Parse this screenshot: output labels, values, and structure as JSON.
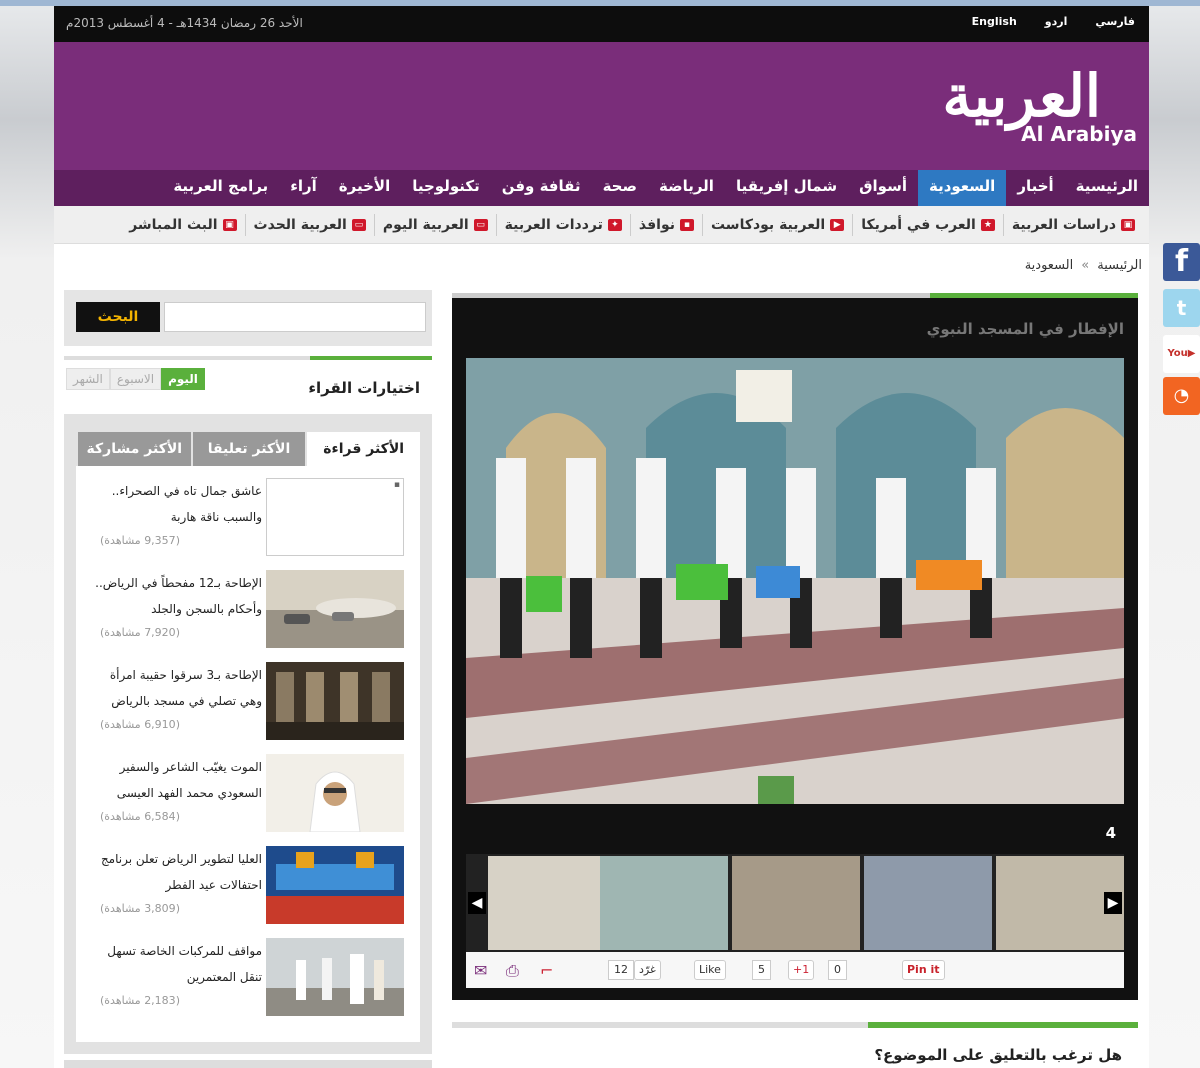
{
  "topbar": {
    "date": "الأحد 26 رمضان 1434هـ - 4 أغسطس 2013م",
    "languages": [
      "فارسي",
      "اردو",
      "English"
    ]
  },
  "logo": {
    "arabic": "العربية",
    "english": "Al Arabiya"
  },
  "main_nav": {
    "items": [
      "الرئيسية",
      "أخبار",
      "السعودية",
      "أسواق",
      "شمال إفريقيا",
      "الرياضة",
      "صحة",
      "ثقافة وفن",
      "تكنولوجيا",
      "الأخيرة",
      "آراء",
      "برامج العربية"
    ],
    "active": "السعودية"
  },
  "sub_nav": {
    "items": [
      "دراسات العربية",
      "العرب في أمريكا",
      "العربية بودكاست",
      "نوافذ",
      "ترددات العربية",
      "العربية اليوم",
      "العربية الحدث",
      "البث المباشر"
    ]
  },
  "breadcrumb": {
    "home": "الرئيسية",
    "sep": "»",
    "current": "السعودية"
  },
  "search": {
    "button": "البحث",
    "placeholder": ""
  },
  "readers_picks": {
    "title": "اختيارات القراء",
    "periods": [
      "اليوم",
      "الاسبوع",
      "الشهر"
    ],
    "active_period": "اليوم"
  },
  "most_tabs": {
    "tabs": [
      "الأكثر قراءة",
      "الأكثر تعليقا",
      "الأكثر مشاركة"
    ],
    "active": "الأكثر قراءة"
  },
  "most_read": [
    {
      "title": "عاشق جمال تاه في الصحراء.. والسبب ناقة هاربة",
      "views": "(9,357 مشاهدة)",
      "thumb": "broken"
    },
    {
      "title": "الإطاحة بـ12 مفحطاً في الرياض.. وأحكام بالسجن والجلد",
      "views": "(7,920 مشاهدة)",
      "thumb": "cars"
    },
    {
      "title": "الإطاحة بـ3 سرقوا حقيبة امرأة وهي تصلي في مسجد بالرياض",
      "views": "(6,910 مشاهدة)",
      "thumb": "mosque-interior"
    },
    {
      "title": "الموت يغيّب الشاعر والسفير السعودي محمد الفهد العيسى",
      "views": "(6,584 مشاهدة)",
      "thumb": "portrait"
    },
    {
      "title": "العليا لتطوير الرياض تعلن برنامج احتفالات عيد الفطر",
      "views": "(3,809 مشاهدة)",
      "thumb": "stage"
    },
    {
      "title": "مواقف للمركبات الخاصة تسهل تنقل المعتمرين",
      "views": "(2,183 مشاهدة)",
      "thumb": "pilgrims"
    }
  ],
  "gallery": {
    "title": "الإفطار في المسجد النبوي",
    "counter": "4",
    "share": {
      "tweet_label": "غرّد",
      "tweet_count": "12",
      "like_label": "Like",
      "like_count": "5",
      "gplus_label": "+1",
      "gplus_count": "0",
      "pin_label": "Pin it"
    }
  },
  "comment_prompt": "هل ترغب بالتعليق على الموضوع؟",
  "social": [
    "facebook-icon",
    "twitter-icon",
    "youtube-icon",
    "rss-icon"
  ],
  "colors": {
    "brand_purple": "#7a2d7a",
    "nav_purple": "#5e1f5e",
    "active_blue": "#2e79c2",
    "accent_green": "#5ab03c",
    "search_gold": "#f4b400"
  }
}
